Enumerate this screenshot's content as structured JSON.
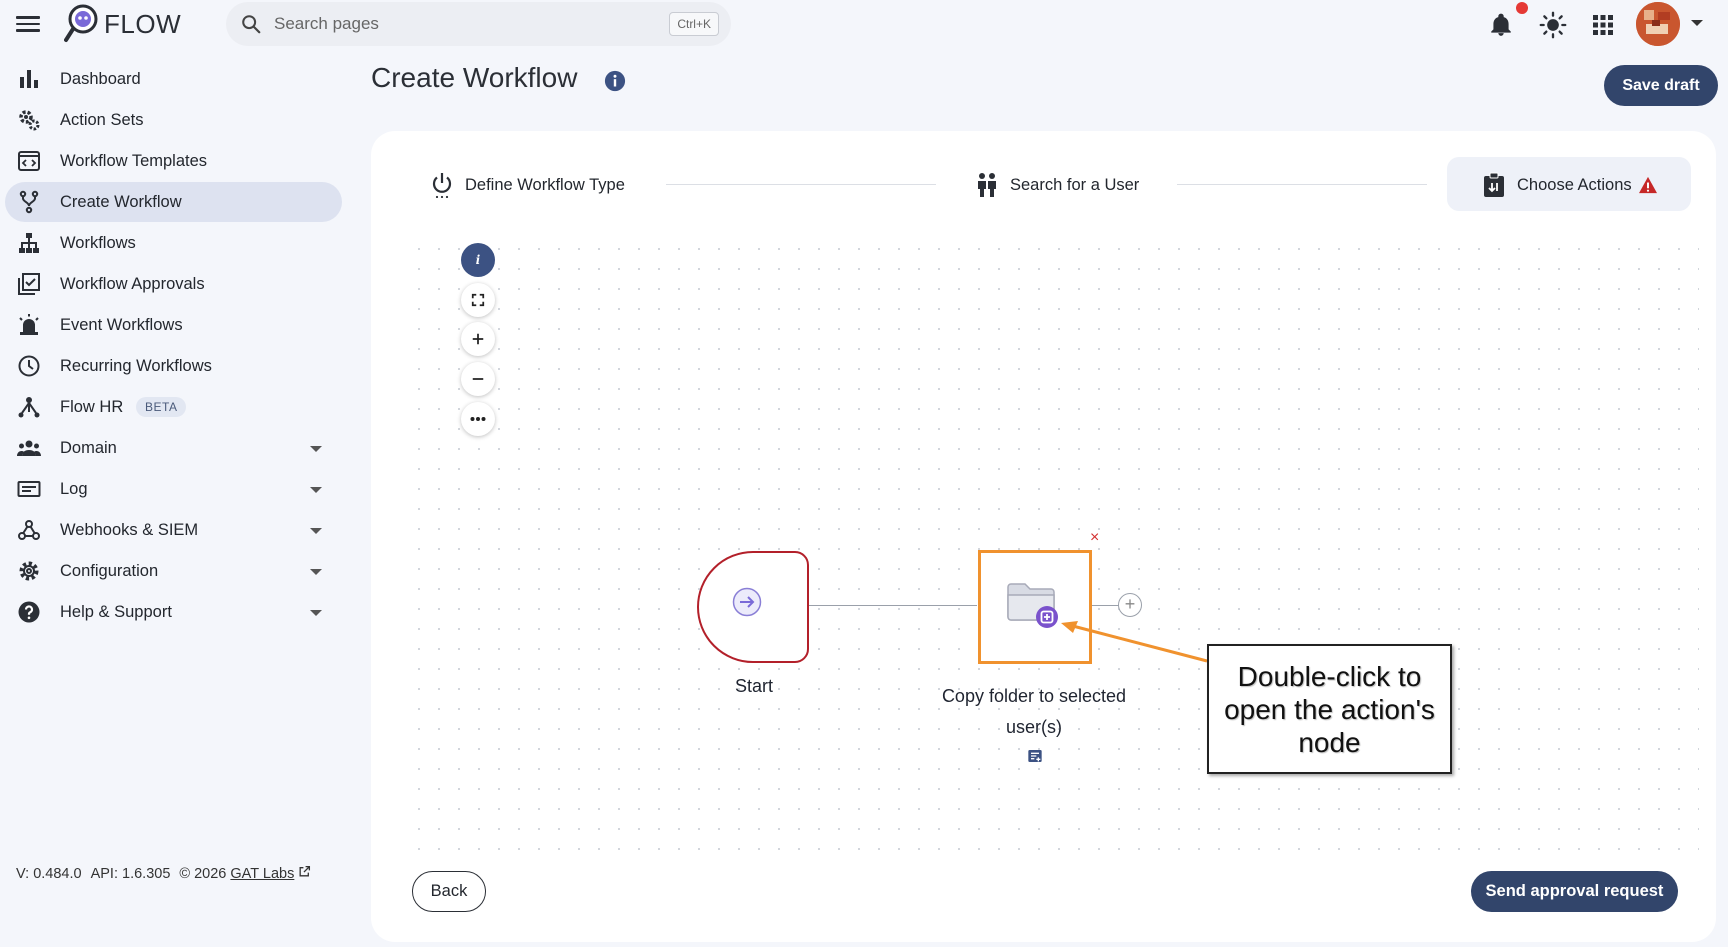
{
  "app": {
    "logo_text": "FLOW"
  },
  "search": {
    "placeholder": "Search pages",
    "shortcut": "Ctrl+K"
  },
  "header": {
    "has_notification": true
  },
  "sidebar": {
    "items": [
      {
        "label": "Dashboard",
        "icon": "bar-chart-icon"
      },
      {
        "label": "Action Sets",
        "icon": "gears-icon"
      },
      {
        "label": "Workflow Templates",
        "icon": "template-icon"
      },
      {
        "label": "Create Workflow",
        "icon": "fork-icon",
        "active": true
      },
      {
        "label": "Workflows",
        "icon": "sitemap-icon"
      },
      {
        "label": "Workflow Approvals",
        "icon": "approval-icon"
      },
      {
        "label": "Event Workflows",
        "icon": "alarm-icon"
      },
      {
        "label": "Recurring Workflows",
        "icon": "clock-icon"
      },
      {
        "label": "Flow HR",
        "icon": "hr-icon",
        "badge": "BETA"
      },
      {
        "label": "Domain",
        "icon": "group-icon",
        "expandable": true
      },
      {
        "label": "Log",
        "icon": "log-icon",
        "expandable": true
      },
      {
        "label": "Webhooks & SIEM",
        "icon": "webhook-icon",
        "expandable": true
      },
      {
        "label": "Configuration",
        "icon": "gear-icon",
        "expandable": true
      },
      {
        "label": "Help & Support",
        "icon": "help-icon",
        "expandable": true
      }
    ]
  },
  "footer": {
    "version": "V: 0.484.0",
    "api": "API: 1.6.305",
    "copyright": "© 2026",
    "company": "GAT Labs"
  },
  "page": {
    "title": "Create Workflow",
    "save_draft": "Save draft"
  },
  "stepper": {
    "steps": [
      {
        "label": "Define Workflow Type"
      },
      {
        "label": "Search for a User"
      },
      {
        "label": "Choose Actions",
        "active": true,
        "warning": true
      }
    ]
  },
  "canvas": {
    "start_label": "Start",
    "action_label": "Copy folder to selected user(s)",
    "remove_symbol": "×",
    "add_symbol": "+",
    "callout": "Double-click to open the action's node"
  },
  "buttons": {
    "back": "Back",
    "send": "Send approval request"
  },
  "colors": {
    "primary": "#32456b",
    "active_nav": "#dde2f0",
    "start_border": "#b3202a",
    "highlight": "#f0922e",
    "warning": "#c62828"
  }
}
